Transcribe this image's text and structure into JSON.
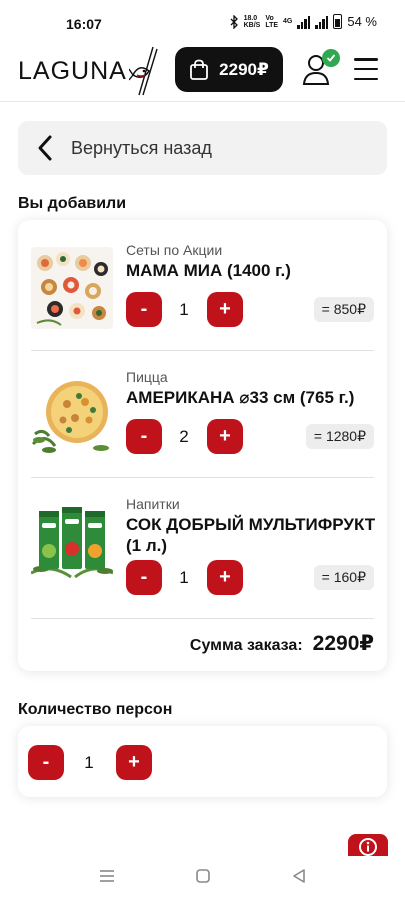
{
  "status_bar": {
    "time": "16:07",
    "net_speed_value": "18.0",
    "net_speed_unit": "KB/S",
    "volte_top": "Vo",
    "volte_bottom": "LTE",
    "network": "4G",
    "battery": "54 %"
  },
  "header": {
    "logo_text": "LAGUNA",
    "cart_total": "2290₽"
  },
  "back": {
    "label": "Вернуться назад"
  },
  "order": {
    "section_title": "Вы добавили",
    "items": [
      {
        "category": "Сеты по Акции",
        "name": "МАМА МИА (1400 г.)",
        "quantity": "1",
        "price": "= 850₽",
        "image": "sushi-set"
      },
      {
        "category": "Пицца",
        "name": "АМЕРИКАНА ⌀33 см (765 г.)",
        "quantity": "2",
        "price": "= 1280₽",
        "image": "pizza"
      },
      {
        "category": "Напитки",
        "name": "СОК ДОБРЫЙ МУЛЬТИФРУКТ (1 л.)",
        "quantity": "1",
        "price": "= 160₽",
        "image": "juice"
      }
    ],
    "minus_label": "-",
    "plus_label": "+",
    "sum_label": "Сумма заказа:",
    "sum_value": "2290₽"
  },
  "persons": {
    "section_title": "Количество персон",
    "quantity": "1",
    "minus_label": "-",
    "plus_label": "+"
  },
  "accent_color": "#c0121b",
  "icons": [
    "bluetooth-icon",
    "signal-icon",
    "battery-icon",
    "shopping-bag-icon",
    "user-icon",
    "check-icon",
    "menu-icon",
    "chevron-left-icon",
    "info-icon",
    "nav-menu-icon",
    "nav-home-icon",
    "nav-back-icon"
  ]
}
